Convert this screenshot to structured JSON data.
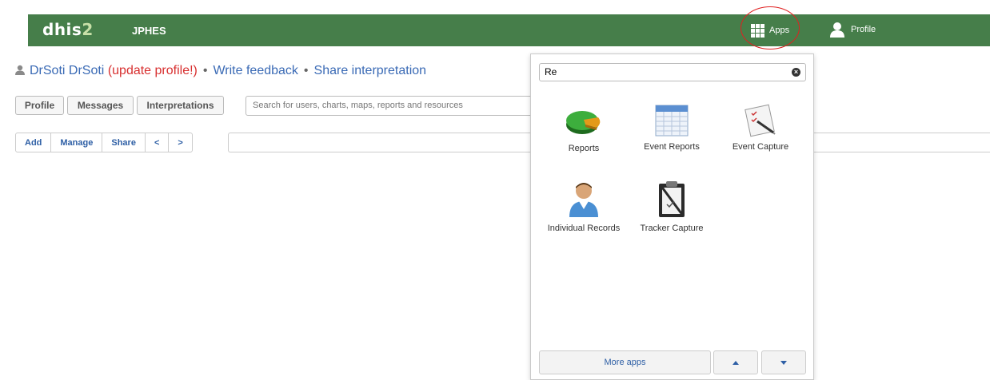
{
  "header": {
    "logo_main": "dhis",
    "logo_digit": "2",
    "instance": "JPHES",
    "apps_label": "Apps",
    "profile_label": "Profile",
    "brand_color": "#467e4a"
  },
  "user_line": {
    "name": "DrSoti DrSoti",
    "update_profile": "(update profile!)",
    "separator": "•",
    "write_feedback": "Write feedback",
    "share_interpretation": "Share interpretation"
  },
  "nav_buttons": {
    "profile": "Profile",
    "messages": "Messages",
    "interpretations": "Interpretations"
  },
  "search": {
    "placeholder": "Search for users, charts, maps, reports and resources"
  },
  "toolbar": {
    "add": "Add",
    "manage": "Manage",
    "share": "Share",
    "prev": "<",
    "next": ">"
  },
  "apps_menu": {
    "filter_value": "Re",
    "clear_icon": "x-circle-icon",
    "apps": [
      {
        "label": "Reports",
        "icon": "pie-chart-icon"
      },
      {
        "label": "Event Reports",
        "icon": "table-icon"
      },
      {
        "label": "Event Capture",
        "icon": "checklist-pen-icon"
      },
      {
        "label": "Individual Records",
        "icon": "person-icon"
      },
      {
        "label": "Tracker Capture",
        "icon": "clipboard-icon"
      }
    ],
    "more_apps": "More apps"
  }
}
